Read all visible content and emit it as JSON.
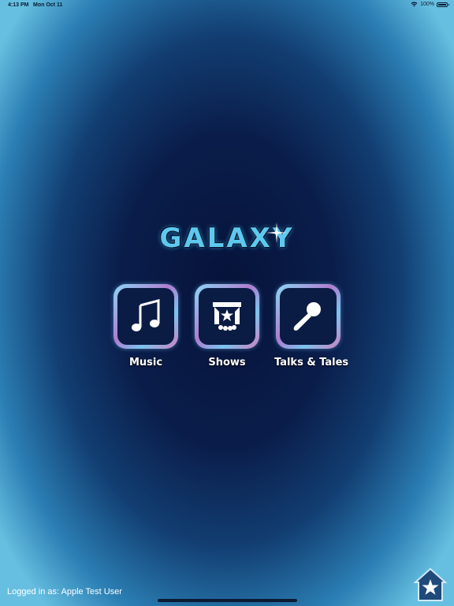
{
  "status_bar": {
    "time": "4:13 PM",
    "date": "Mon Oct 11",
    "battery_text": "100%",
    "battery_level": 1.0
  },
  "logo": {
    "text": "GALAXY"
  },
  "menu": {
    "items": [
      {
        "label": "Music",
        "icon": "music-note-icon"
      },
      {
        "label": "Shows",
        "icon": "stage-icon"
      },
      {
        "label": "Talks & Tales",
        "icon": "microphone-icon"
      }
    ]
  },
  "footer": {
    "logged_in": "Logged in as: Apple Test User",
    "home_icon": "house-star-icon"
  },
  "colors": {
    "background_center": "#06133a",
    "background_edge": "#66bfe0",
    "logo": "#5fc8ef",
    "tile_inner": "#0b1c44"
  }
}
